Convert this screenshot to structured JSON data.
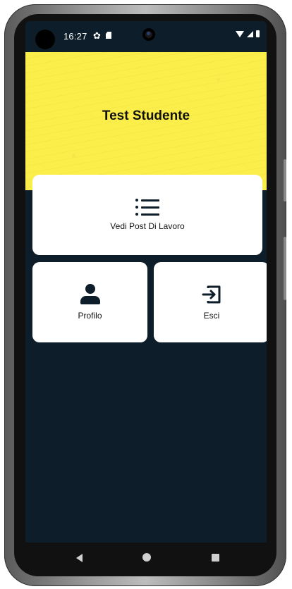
{
  "status_bar": {
    "time": "16:27",
    "icons": [
      "gear-icon",
      "sd-card-icon",
      "wifi-icon",
      "signal-icon",
      "battery-icon"
    ]
  },
  "header": {
    "title": "Test Studente",
    "background_color": "#fbee4b"
  },
  "menu": {
    "job_posts": {
      "label": "Vedi Post Di Lavoro",
      "icon": "list-icon"
    },
    "profile": {
      "label": "Profilo",
      "icon": "person-icon"
    },
    "logout": {
      "label": "Esci",
      "icon": "logout-icon"
    }
  },
  "navigation_bar": {
    "buttons": [
      "back",
      "home",
      "recents"
    ]
  },
  "colors": {
    "screen_background": "#0d1e2a",
    "card_background": "#ffffff",
    "icon_color": "#0d1e2a"
  }
}
